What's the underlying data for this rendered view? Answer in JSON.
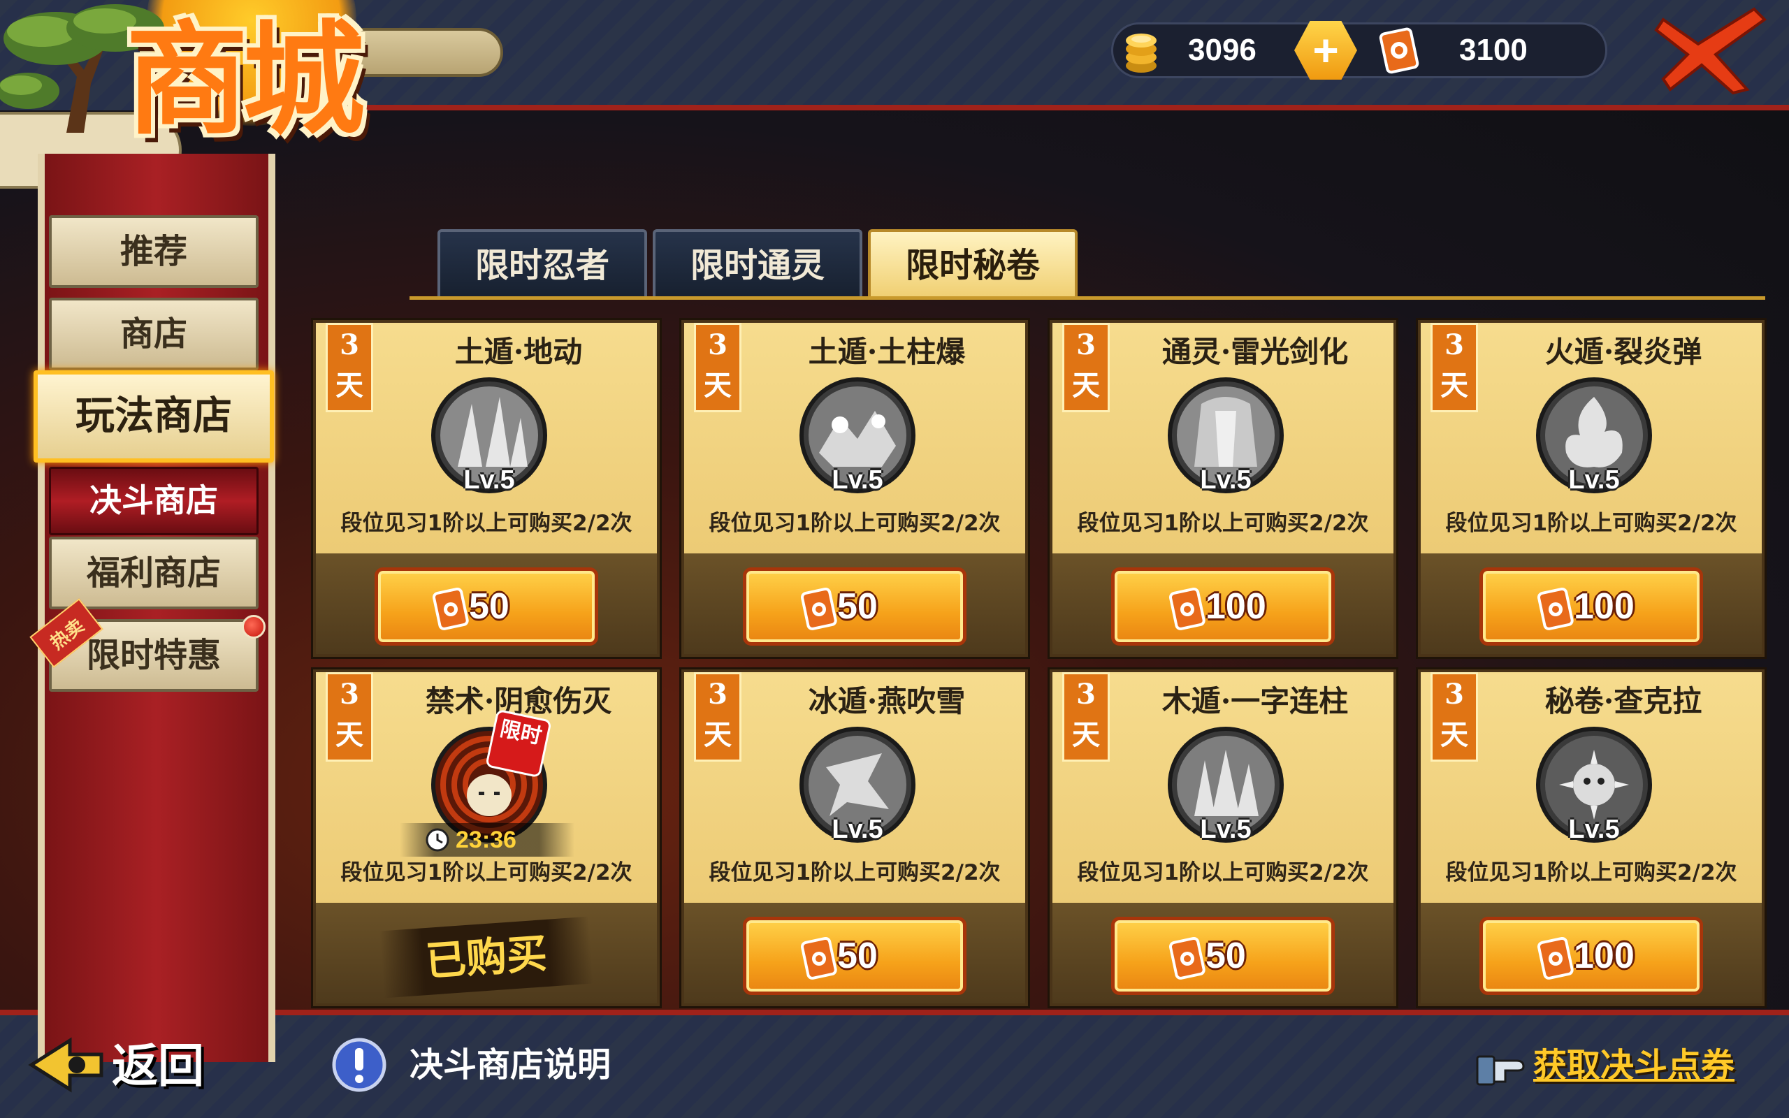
{
  "title": "商城",
  "currency": {
    "gold_value": "3096",
    "add_label": "+",
    "ticket_value": "3100"
  },
  "sidebar": {
    "items": [
      {
        "label": "推荐"
      },
      {
        "label": "商店"
      },
      {
        "label": "玩法商店",
        "active": true
      },
      {
        "label": "决斗商店",
        "sub": true
      },
      {
        "label": "福利商店"
      },
      {
        "label": "限时特惠"
      }
    ],
    "hot_tag": "热卖"
  },
  "tabs": [
    {
      "label": "限时忍者"
    },
    {
      "label": "限时通灵"
    },
    {
      "label": "限时秘卷",
      "active": true
    }
  ],
  "days_badge": "3天",
  "level_label": "Lv.5",
  "cards": [
    {
      "name": "土遁·地动",
      "desc": "段位见习1阶以上可购买2/2次",
      "price": "50"
    },
    {
      "name": "土遁·土柱爆",
      "desc": "段位见习1阶以上可购买2/2次",
      "price": "50"
    },
    {
      "name": "通灵·雷光剑化",
      "desc": "段位见习1阶以上可购买2/2次",
      "price": "100"
    },
    {
      "name": "火遁·裂炎弹",
      "desc": "段位见习1阶以上可购买2/2次",
      "price": "100"
    },
    {
      "name": "禁术·阴愈伤灭",
      "desc": "段位见习1阶以上可购买2/2次",
      "sold_label": "已购买",
      "limited": "限时",
      "timer": "23:36"
    },
    {
      "name": "冰遁·燕吹雪",
      "desc": "段位见习1阶以上可购买2/2次",
      "price": "50"
    },
    {
      "name": "木遁·一字连柱",
      "desc": "段位见习1阶以上可购买2/2次",
      "price": "50"
    },
    {
      "name": "秘卷·查克拉",
      "desc": "段位见习1阶以上可购买2/2次",
      "price": "100"
    }
  ],
  "footer": {
    "back_label": "返回",
    "help_label": "决斗商店说明",
    "get_tickets_label": "获取决斗点券"
  },
  "colors": {
    "accent_orange": "#f6a21a",
    "tab_active": "#f0cf71",
    "sidebar_red": "#a92024",
    "link_yellow": "#ffc928"
  }
}
